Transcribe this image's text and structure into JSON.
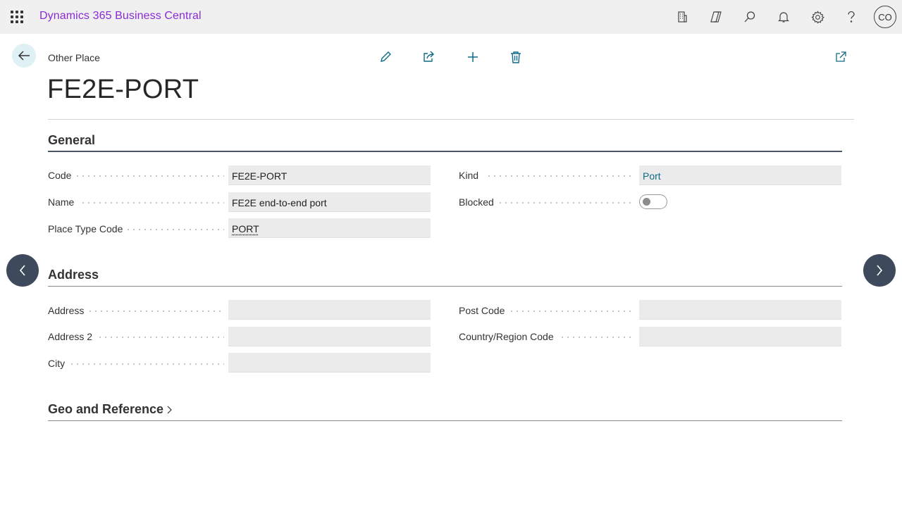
{
  "topbar": {
    "app_title": "Dynamics 365 Business Central",
    "icons": [
      "waffle-icon",
      "document-icon",
      "copilot-icon",
      "search-icon",
      "bell-icon",
      "gear-icon",
      "help-icon"
    ],
    "avatar_initials": "CO"
  },
  "header": {
    "caption": "Other Place",
    "title": "FE2E-PORT",
    "actions": [
      "edit-icon",
      "share-icon",
      "new-icon",
      "delete-icon",
      "open-new-window-icon"
    ]
  },
  "general": {
    "title": "General",
    "code_label": "Code",
    "code_value": "FE2E-PORT",
    "name_label": "Name",
    "name_value": "FE2E end-to-end port",
    "place_type_label": "Place Type Code",
    "place_type_value": "PORT",
    "kind_label": "Kind",
    "kind_value": "Port",
    "blocked_label": "Blocked",
    "blocked_value": false
  },
  "address": {
    "title": "Address",
    "address_label": "Address",
    "address_value": "",
    "address2_label": "Address 2",
    "address2_value": "",
    "city_label": "City",
    "city_value": "",
    "post_code_label": "Post Code",
    "post_code_value": "",
    "country_label": "Country/Region Code",
    "country_value": ""
  },
  "geo": {
    "title": "Geo and Reference"
  },
  "colors": {
    "accent": "#8a2bd6",
    "link": "#0f6c87",
    "nav_button": "#3d4a5c",
    "field_bg": "#ebebeb"
  }
}
